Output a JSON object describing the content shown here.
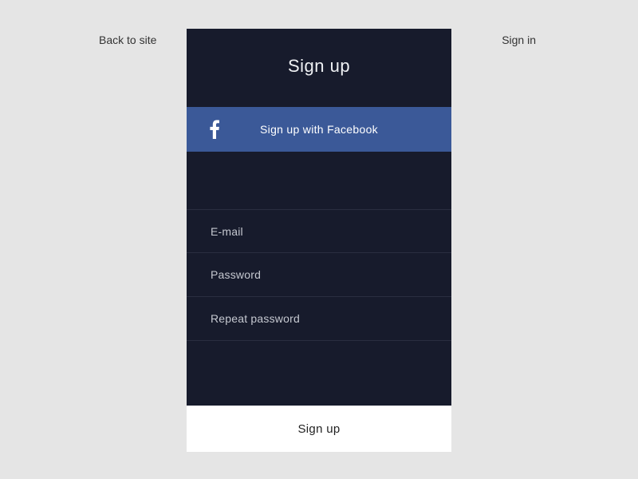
{
  "nav": {
    "back_label": "Back to site",
    "signin_label": "Sign in"
  },
  "card": {
    "title": "Sign up",
    "facebook": {
      "label": "Sign up with Facebook"
    },
    "fields": {
      "email_placeholder": "E-mail",
      "email_value": "",
      "password_placeholder": "Password",
      "password_value": "",
      "repeat_placeholder": "Repeat password",
      "repeat_value": ""
    },
    "submit_label": "Sign up"
  },
  "colors": {
    "page_bg": "#e5e5e5",
    "card_bg": "#171b2c",
    "facebook_bg": "#3b5998",
    "submit_bg": "#ffffff"
  }
}
